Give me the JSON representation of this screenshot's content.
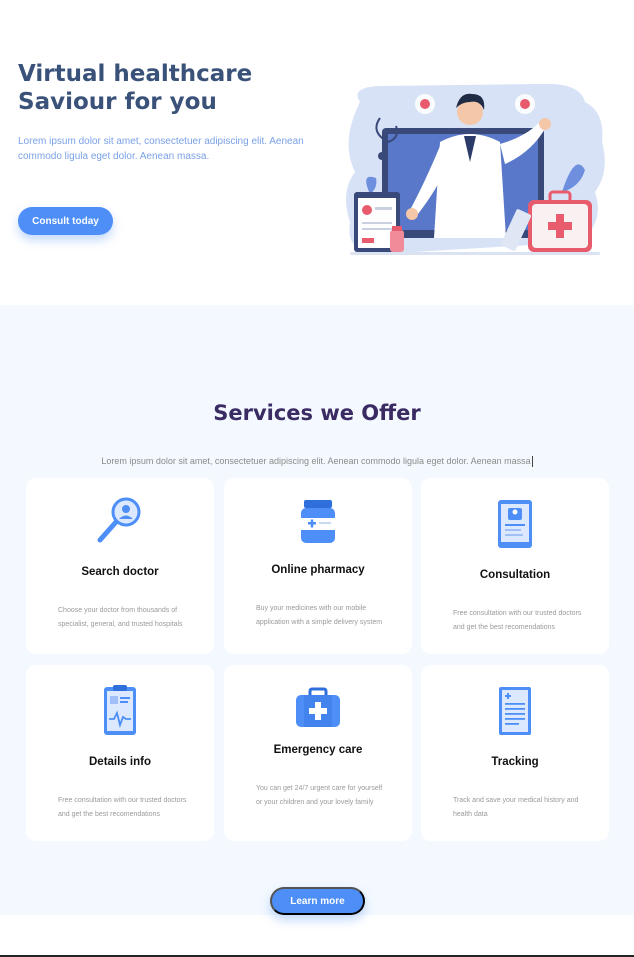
{
  "hero": {
    "title": "Virtual healthcare Saviour for you",
    "subtitle": "Lorem ipsum dolor sit amet, consectetuer adipiscing elit. Aenean commodo ligula eget dolor. Aenean massa.",
    "cta_label": "Consult today"
  },
  "services": {
    "title": "Services we Offer",
    "subtitle": "Lorem ipsum dolor sit amet, consectetuer adipiscing elit. Aenean commodo ligula eget dolor. Aenean massa",
    "cards": [
      {
        "title": "Search doctor",
        "icon": "magnifier-doctor-icon",
        "desc": "Choose your doctor from thousands of specialist, general, and trusted hospitals"
      },
      {
        "title": "Online pharmacy",
        "icon": "medicine-bottle-icon",
        "desc": "Buy your medicines with our mobile application with a simple delivery system"
      },
      {
        "title": "Consultation",
        "icon": "tablet-doctor-icon",
        "desc": "Free consultation with our trusted doctors and get the best recomendations"
      },
      {
        "title": "Details info",
        "icon": "clipboard-heartbeat-icon",
        "desc": "Free consultation with our trusted doctors and get the best recomendations"
      },
      {
        "title": "Emergency care",
        "icon": "first-aid-kit-icon",
        "desc": "You can get 24/7 urgent care for yourself or your children and your lovely family"
      },
      {
        "title": "Tracking",
        "icon": "medical-report-icon",
        "desc": "Track and save your medical history and health data"
      }
    ],
    "cta_label": "Learn more"
  },
  "colors": {
    "primary": "#4d8ef7",
    "hero_title": "#3a5279",
    "hero_sub": "#7aa1e6",
    "services_title": "#3a2b63",
    "services_bg": "#f3f9fe"
  }
}
